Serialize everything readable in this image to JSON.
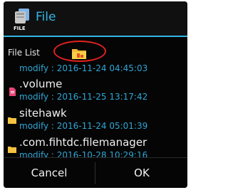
{
  "dialog": {
    "title": "File",
    "icon_caption": "FILE"
  },
  "path_bar": {
    "label": "File List"
  },
  "files": [
    {
      "name": "",
      "meta": "modify : 2016-11-24 04:45:03",
      "icon": "folder-icon"
    },
    {
      "name": ".volume",
      "meta": "modify : 2016-11-25 13:17:42",
      "icon": "file-icon"
    },
    {
      "name": "sitehawk",
      "meta": "modify : 2016-11-24 05:01:39",
      "icon": "folder-icon"
    },
    {
      "name": ".com.fihtdc.filemanager",
      "meta": "modify : 2016-10-28 10:29:16",
      "icon": "folder-icon"
    }
  ],
  "buttons": {
    "cancel": "Cancel",
    "ok": "OK"
  },
  "colors": {
    "accent": "#33b5e5",
    "highlight_circle": "#e4221f",
    "folder": "#f5c242",
    "file": "#e8457a"
  }
}
